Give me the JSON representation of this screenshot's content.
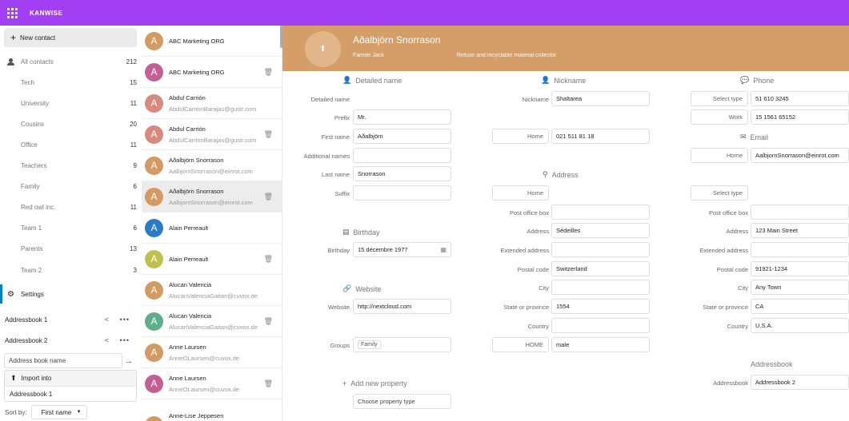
{
  "header": {
    "brand": "KANWISE"
  },
  "sidebar": {
    "new_contact": "New contact",
    "items": [
      {
        "label": "All contacts",
        "count": "212"
      },
      {
        "label": "Tech",
        "count": "15"
      },
      {
        "label": "University",
        "count": "11"
      },
      {
        "label": "Cousins",
        "count": "20"
      },
      {
        "label": "Office",
        "count": "11"
      },
      {
        "label": "Teachers",
        "count": "9"
      },
      {
        "label": "Family",
        "count": "6"
      },
      {
        "label": "Red owl inc.",
        "count": "11"
      },
      {
        "label": "Team 1",
        "count": "6"
      },
      {
        "label": "Parents",
        "count": "13"
      },
      {
        "label": "Team 2",
        "count": "3"
      }
    ],
    "settings": "Settings",
    "addressbooks": [
      "Addressbook 1",
      "Addressbook 2"
    ],
    "ab_name_placeholder": "Address book name",
    "import_into": "Import into",
    "import_target": "Addressbook 1",
    "sort_by_label": "Sort by:",
    "sort_by_value": "First name"
  },
  "contacts": [
    {
      "initial": "A",
      "name": "ABC Marketing ORG",
      "email": "",
      "color": "#d49a63"
    },
    {
      "initial": "A",
      "name": "ABC Marketing ORG",
      "email": "",
      "color": "#c25f95"
    },
    {
      "initial": "A",
      "name": "Abdul Carrión",
      "email": "AbdulCarrionBarajas@gustr.com",
      "color": "#d98a7e"
    },
    {
      "initial": "A",
      "name": "Abdul Carrión",
      "email": "AbdulCarrionBarajas@gustr.com",
      "color": "#d98a7e"
    },
    {
      "initial": "A",
      "name": "Aðalbjörn Snorrason",
      "email": "AalbjornSnorrason@einrot.com",
      "color": "#d49a63"
    },
    {
      "initial": "A",
      "name": "Aðalbjörn Snorrason",
      "email": "AalbjornSnorrason@einrot.com",
      "color": "#d49a63"
    },
    {
      "initial": "A",
      "name": "Alain Perreault",
      "email": "",
      "color": "#2b7bc4"
    },
    {
      "initial": "A",
      "name": "Alain Perreault",
      "email": "",
      "color": "#bfc14e"
    },
    {
      "initial": "A",
      "name": "Alucan Valencia",
      "email": "AlucanValenciaGaitan@cuvox.de",
      "color": "#d49a63"
    },
    {
      "initial": "A",
      "name": "Alucan Valencia",
      "email": "AlucanValenciaGaitan@cuvox.de",
      "color": "#5fae8b"
    },
    {
      "initial": "A",
      "name": "Anne Laursen",
      "email": "AnneOLaursen@cuvox.de",
      "color": "#d49a63"
    },
    {
      "initial": "A",
      "name": "Anne Laursen",
      "email": "AnneOLaursen@cuvox.de",
      "color": "#c25f95"
    },
    {
      "initial": "A",
      "name": "Anne-Lise Jeppesen",
      "email": "",
      "color": "#d49a63"
    }
  ],
  "details": {
    "name": "Aðalbjörn Snorrason",
    "org": "Farmer Jack",
    "title": "Refuse and recyclable material collector",
    "detailed_name": {
      "title": "Detailed name",
      "label_main": "Detailed name",
      "prefix_label": "Prefix",
      "prefix": "Mr.",
      "first_label": "First name",
      "first": "Aðalbjörn",
      "additional_label": "Additional names",
      "additional": "",
      "last_label": "Last name",
      "last": "Snorrason",
      "suffix_label": "Suffix",
      "suffix": ""
    },
    "birthday": {
      "title": "Birthday",
      "label": "Birthday",
      "value": "15 décembre 1977"
    },
    "website": {
      "title": "Website",
      "label": "Website",
      "value": "http://nextcloud.com"
    },
    "groups": {
      "label": "Groups",
      "value": "Family"
    },
    "add_property": {
      "title": "Add new property",
      "placeholder": "Choose property type"
    },
    "nickname": {
      "title": "Nickname",
      "label": "Nickname",
      "value": "Shaltarea",
      "home_type": "Home",
      "home_value": "021 511 81 18"
    },
    "address1": {
      "title": "Address",
      "type": "Home",
      "pobox_label": "Post office box",
      "pobox": "",
      "address_label": "Address",
      "address": "Sédeilles",
      "extended_label": "Extended address",
      "extended": "",
      "postal_label": "Postal code",
      "postal": "Switzerland",
      "city_label": "City",
      "city": "",
      "state_label": "State or province",
      "state": "1554",
      "country_label": "Country",
      "country": "",
      "extra_type": "HOME",
      "extra_value": "male"
    },
    "phone": {
      "title": "Phone",
      "type1": "Select type",
      "value1": "51 610 3245",
      "type2": "Work",
      "value2": "15 1561 65152"
    },
    "email": {
      "title": "Email",
      "type": "Home",
      "value": "AalbjornSnorrason@einrot.com"
    },
    "address2": {
      "type": "Select type",
      "pobox_label": "Post office box",
      "pobox": "",
      "address_label": "Address",
      "address": "123 Main Street",
      "extended_label": "Extended address",
      "extended": "",
      "postal_label": "Postal code",
      "postal": "91921-1234",
      "city_label": "City",
      "city": "Any Town",
      "state_label": "State or province",
      "state": "CA",
      "country_label": "Country",
      "country": "U.S.A."
    },
    "addressbook": {
      "title": "Addressbook",
      "label": "Addressbook",
      "value": "Addressbook 2"
    }
  }
}
